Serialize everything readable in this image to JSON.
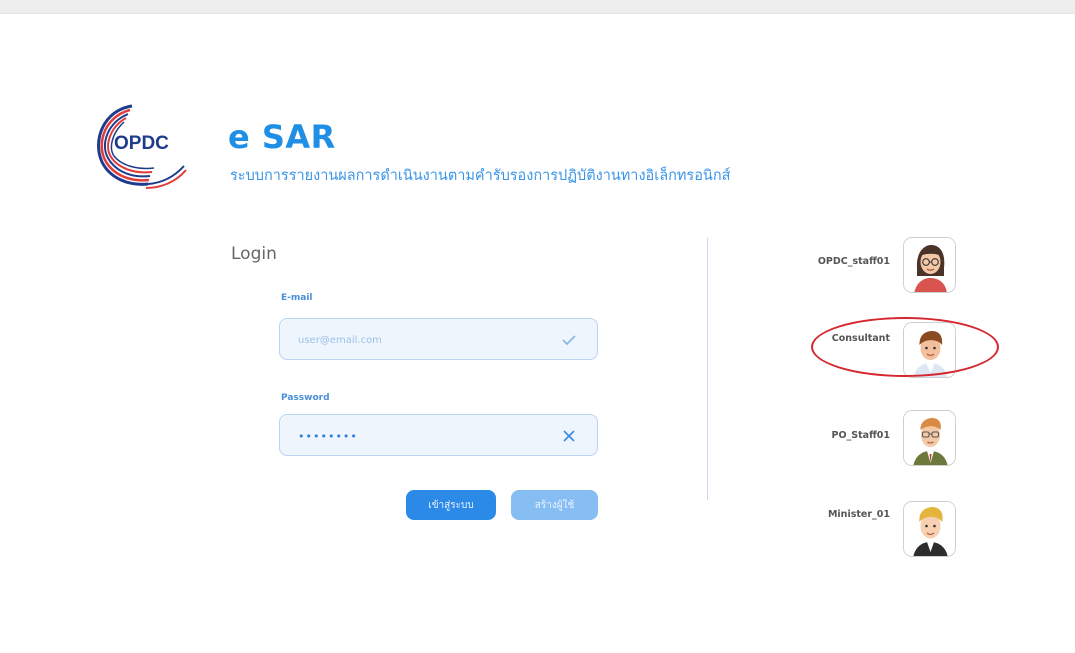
{
  "header": {
    "logo_text": "OPDC",
    "title": "e SAR",
    "subtitle": "ระบบการรายงานผลการดำเนินงานตามคำรับรองการปฏิบัติงานทางอิเล็กทรอนิกส์"
  },
  "login": {
    "title": "Login",
    "email_label": "E-mail",
    "email_placeholder": "user@email.com",
    "password_label": "Password",
    "password_value": "••••••••",
    "login_button": "เข้าสู่ระบบ",
    "register_button": "สร้างผู้ใช้"
  },
  "users": [
    {
      "name": "OPDC_staff01",
      "avatar": "female-staff-avatar"
    },
    {
      "name": "Consultant",
      "avatar": "male-consultant-avatar"
    },
    {
      "name": "PO_Staff01",
      "avatar": "male-glasses-avatar"
    },
    {
      "name": "Minister_01",
      "avatar": "blond-man-avatar"
    }
  ],
  "colors": {
    "brand": "#1f8fe6",
    "button_primary": "#2b8ae8",
    "button_secondary": "#86bdf3",
    "highlight": "#d6262e"
  }
}
